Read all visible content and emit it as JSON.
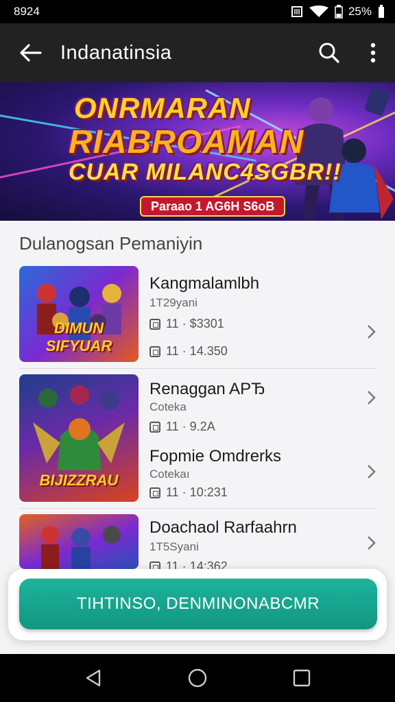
{
  "status_bar": {
    "time": "8924",
    "battery": "25%"
  },
  "app_bar": {
    "title": "Indanatinsia"
  },
  "banner": {
    "line1": "ONRMARAN",
    "line2": "RIABROAMAN",
    "line3": "CUAR MILANC4SGBR!!",
    "tag": "Paraao 1 AG6H S6oB"
  },
  "section": {
    "title": "Dulanogsan Pemaniyin"
  },
  "items": [
    {
      "name": "Kangmalamlbh",
      "sub": "1T29yani",
      "meta1": "11 · $3301",
      "meta2": "11 · 14.350",
      "thumb_caption": "DIMUN SIFYUAR",
      "thumb_top": ""
    },
    {
      "name": "Renaggan APЂ",
      "sub": "Coteka",
      "meta1": "11 · 9.2A",
      "meta2": "",
      "thumb_caption": "BIJIZZRAU",
      "thumb_top": ""
    },
    {
      "name": "Fopmie Omdrerks",
      "sub": "Cotekaı",
      "meta1": "11 · 10:231",
      "meta2": "",
      "thumb_caption": "",
      "thumb_top": ""
    },
    {
      "name": "Doachaol Rarfaahrn",
      "sub": "1T5Syani",
      "meta1": "11 · 14:362",
      "meta2": "",
      "thumb_caption": "",
      "thumb_top": ""
    }
  ],
  "cta": {
    "label": "TIHTINSO, DENMINONABCMR"
  },
  "colors": {
    "accent": "#1aa98f",
    "app_bar": "#222222",
    "banner_tag": "#c4182b"
  },
  "icons": [
    "back-arrow-icon",
    "search-icon",
    "more-vert-icon",
    "chevron-right-icon",
    "calendar-icon",
    "nav-back-icon",
    "nav-home-icon",
    "nav-recents-icon",
    "wifi-icon",
    "signal-icon",
    "battery-icon",
    "nfc-icon"
  ]
}
